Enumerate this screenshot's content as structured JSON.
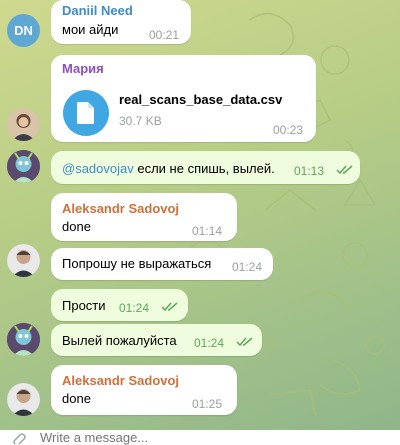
{
  "messages": [
    {
      "sender": "Daniil Need",
      "sender_color": "#3c8dc8",
      "avatar_initials": "DN",
      "text": "мои айди",
      "time": "00:21"
    },
    {
      "sender": "Мария",
      "sender_color": "#8e4ec6",
      "file_name": "real_scans_base_data.csv",
      "file_size": "30.7 KB",
      "time": "00:23"
    },
    {
      "mention": "@sadovojav",
      "text": " если не спишь, вылей.",
      "time": "01:13",
      "read": true
    },
    {
      "sender": "Aleksandr Sadovoj",
      "sender_color": "#d2703a",
      "text": "done",
      "time": "01:14"
    },
    {
      "text": "Попрошу не выражаться",
      "time": "01:24"
    },
    {
      "text": "Прости",
      "time": "01:24",
      "read": true
    },
    {
      "text": "Вылей пожалуйста",
      "time": "01:24",
      "read": true
    },
    {
      "sender": "Aleksandr Sadovoj",
      "sender_color": "#d2703a",
      "text": "done",
      "time": "01:25"
    }
  ],
  "composer": {
    "placeholder": "Write a message..."
  },
  "colors": {
    "outgoing_bubble": "#effdde",
    "incoming_bubble": "#ffffff",
    "accent": "#40a7e3",
    "read_check": "#5ba85e"
  }
}
